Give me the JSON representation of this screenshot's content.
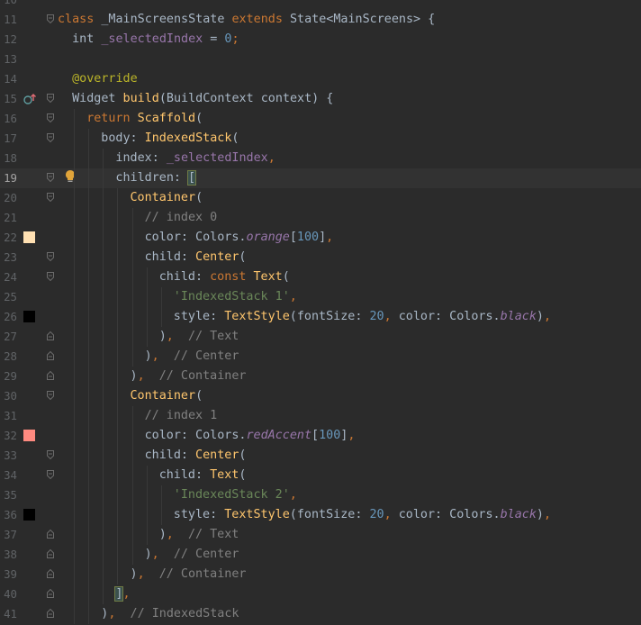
{
  "editor": {
    "colors": {
      "background": "#2b2b2b",
      "caret_line": "#323232",
      "orange_100": "#ffe0b2",
      "red_accent_100": "#ff8a80",
      "black": "#000000",
      "bulb": "#e0a43a"
    },
    "lines": [
      {
        "number": "10",
        "indent": 0,
        "fold": "",
        "gutter": "",
        "tokens": []
      },
      {
        "number": "11",
        "indent": 0,
        "fold": "open",
        "gutter": "",
        "tokens": [
          {
            "t": "class ",
            "c": "keyword"
          },
          {
            "t": "_MainScreensState ",
            "c": "plain"
          },
          {
            "t": "extends ",
            "c": "keyword"
          },
          {
            "t": "State<MainScreens> {",
            "c": "plain"
          }
        ]
      },
      {
        "number": "12",
        "indent": 1,
        "fold": "",
        "gutter": "",
        "tokens": [
          {
            "t": "int ",
            "c": "plain"
          },
          {
            "t": "_selectedIndex",
            "c": "field"
          },
          {
            "t": " = ",
            "c": "plain"
          },
          {
            "t": "0",
            "c": "number"
          },
          {
            "t": ";",
            "c": "keyword"
          }
        ]
      },
      {
        "number": "13",
        "indent": 0,
        "fold": "",
        "gutter": "",
        "tokens": []
      },
      {
        "number": "14",
        "indent": 1,
        "fold": "",
        "gutter": "",
        "tokens": [
          {
            "t": "@override",
            "c": "annotation"
          }
        ]
      },
      {
        "number": "15",
        "indent": 1,
        "fold": "open",
        "gutter": "override-icon",
        "tokens": [
          {
            "t": "Widget ",
            "c": "plain"
          },
          {
            "t": "build",
            "c": "method"
          },
          {
            "t": "(BuildContext context) {",
            "c": "plain"
          }
        ]
      },
      {
        "number": "16",
        "indent": 2,
        "fold": "open",
        "gutter": "",
        "tokens": [
          {
            "t": "return ",
            "c": "keyword"
          },
          {
            "t": "Scaffold",
            "c": "class"
          },
          {
            "t": "(",
            "c": "plain"
          }
        ]
      },
      {
        "number": "17",
        "indent": 3,
        "fold": "open",
        "gutter": "",
        "tokens": [
          {
            "t": "body: ",
            "c": "named"
          },
          {
            "t": "IndexedStack",
            "c": "class"
          },
          {
            "t": "(",
            "c": "plain"
          }
        ]
      },
      {
        "number": "18",
        "indent": 4,
        "fold": "",
        "gutter": "",
        "tokens": [
          {
            "t": "index: ",
            "c": "named"
          },
          {
            "t": "_selectedIndex",
            "c": "field"
          },
          {
            "t": ",",
            "c": "keyword"
          }
        ]
      },
      {
        "number": "19",
        "indent": 4,
        "fold": "open",
        "gutter": "",
        "caret_line": true,
        "bulb": true,
        "tokens": [
          {
            "t": "children: ",
            "c": "named"
          },
          {
            "t": "[",
            "c": "bracket-match"
          },
          {
            "t": "",
            "c": "caret"
          }
        ]
      },
      {
        "number": "20",
        "indent": 5,
        "fold": "open",
        "gutter": "",
        "tokens": [
          {
            "t": "Container",
            "c": "class"
          },
          {
            "t": "(",
            "c": "plain"
          }
        ]
      },
      {
        "number": "21",
        "indent": 6,
        "fold": "",
        "gutter": "",
        "tokens": [
          {
            "t": "// index 0",
            "c": "comment"
          }
        ]
      },
      {
        "number": "22",
        "indent": 6,
        "fold": "",
        "gutter": "swatch-orange",
        "tokens": [
          {
            "t": "color: ",
            "c": "named"
          },
          {
            "t": "Colors.",
            "c": "plain"
          },
          {
            "t": "orange",
            "c": "static"
          },
          {
            "t": "[",
            "c": "plain"
          },
          {
            "t": "100",
            "c": "number"
          },
          {
            "t": "]",
            "c": "plain"
          },
          {
            "t": ",",
            "c": "keyword"
          }
        ]
      },
      {
        "number": "23",
        "indent": 6,
        "fold": "open",
        "gutter": "",
        "tokens": [
          {
            "t": "child: ",
            "c": "named"
          },
          {
            "t": "Center",
            "c": "class"
          },
          {
            "t": "(",
            "c": "plain"
          }
        ]
      },
      {
        "number": "24",
        "indent": 7,
        "fold": "open",
        "gutter": "",
        "tokens": [
          {
            "t": "child: ",
            "c": "named"
          },
          {
            "t": "const ",
            "c": "keyword"
          },
          {
            "t": "Text",
            "c": "class"
          },
          {
            "t": "(",
            "c": "plain"
          }
        ]
      },
      {
        "number": "25",
        "indent": 8,
        "fold": "",
        "gutter": "",
        "tokens": [
          {
            "t": "'IndexedStack 1'",
            "c": "string"
          },
          {
            "t": ",",
            "c": "keyword"
          }
        ]
      },
      {
        "number": "26",
        "indent": 8,
        "fold": "",
        "gutter": "swatch-black",
        "tokens": [
          {
            "t": "style: ",
            "c": "named"
          },
          {
            "t": "TextStyle",
            "c": "class"
          },
          {
            "t": "(fontSize: ",
            "c": "plain"
          },
          {
            "t": "20",
            "c": "number"
          },
          {
            "t": ", ",
            "c": "keyword"
          },
          {
            "t": "color: ",
            "c": "named"
          },
          {
            "t": "Colors.",
            "c": "plain"
          },
          {
            "t": "black",
            "c": "static"
          },
          {
            "t": ")",
            "c": "plain"
          },
          {
            "t": ",",
            "c": "keyword"
          }
        ]
      },
      {
        "number": "27",
        "indent": 7,
        "fold": "close",
        "gutter": "",
        "tokens": [
          {
            "t": ")",
            "c": "plain"
          },
          {
            "t": ",  ",
            "c": "keyword"
          },
          {
            "t": "// Text",
            "c": "comment"
          }
        ]
      },
      {
        "number": "28",
        "indent": 6,
        "fold": "close",
        "gutter": "",
        "tokens": [
          {
            "t": ")",
            "c": "plain"
          },
          {
            "t": ",  ",
            "c": "keyword"
          },
          {
            "t": "// Center",
            "c": "comment"
          }
        ]
      },
      {
        "number": "29",
        "indent": 5,
        "fold": "close",
        "gutter": "",
        "tokens": [
          {
            "t": ")",
            "c": "plain"
          },
          {
            "t": ",  ",
            "c": "keyword"
          },
          {
            "t": "// Container",
            "c": "comment"
          }
        ]
      },
      {
        "number": "30",
        "indent": 5,
        "fold": "open",
        "gutter": "",
        "tokens": [
          {
            "t": "Container",
            "c": "class"
          },
          {
            "t": "(",
            "c": "plain"
          }
        ]
      },
      {
        "number": "31",
        "indent": 6,
        "fold": "",
        "gutter": "",
        "tokens": [
          {
            "t": "// index 1",
            "c": "comment"
          }
        ]
      },
      {
        "number": "32",
        "indent": 6,
        "fold": "",
        "gutter": "swatch-red",
        "tokens": [
          {
            "t": "color: ",
            "c": "named"
          },
          {
            "t": "Colors.",
            "c": "plain"
          },
          {
            "t": "redAccent",
            "c": "static"
          },
          {
            "t": "[",
            "c": "plain"
          },
          {
            "t": "100",
            "c": "number"
          },
          {
            "t": "]",
            "c": "plain"
          },
          {
            "t": ",",
            "c": "keyword"
          }
        ]
      },
      {
        "number": "33",
        "indent": 6,
        "fold": "open",
        "gutter": "",
        "tokens": [
          {
            "t": "child: ",
            "c": "named"
          },
          {
            "t": "Center",
            "c": "class"
          },
          {
            "t": "(",
            "c": "plain"
          }
        ]
      },
      {
        "number": "34",
        "indent": 7,
        "fold": "open",
        "gutter": "",
        "tokens": [
          {
            "t": "child: ",
            "c": "named"
          },
          {
            "t": "Text",
            "c": "class"
          },
          {
            "t": "(",
            "c": "plain"
          }
        ]
      },
      {
        "number": "35",
        "indent": 8,
        "fold": "",
        "gutter": "",
        "tokens": [
          {
            "t": "'IndexedStack 2'",
            "c": "string"
          },
          {
            "t": ",",
            "c": "keyword"
          }
        ]
      },
      {
        "number": "36",
        "indent": 8,
        "fold": "",
        "gutter": "swatch-black",
        "tokens": [
          {
            "t": "style: ",
            "c": "named"
          },
          {
            "t": "TextStyle",
            "c": "class"
          },
          {
            "t": "(fontSize: ",
            "c": "plain"
          },
          {
            "t": "20",
            "c": "number"
          },
          {
            "t": ", ",
            "c": "keyword"
          },
          {
            "t": "color: ",
            "c": "named"
          },
          {
            "t": "Colors.",
            "c": "plain"
          },
          {
            "t": "black",
            "c": "static"
          },
          {
            "t": ")",
            "c": "plain"
          },
          {
            "t": ",",
            "c": "keyword"
          }
        ]
      },
      {
        "number": "37",
        "indent": 7,
        "fold": "close",
        "gutter": "",
        "tokens": [
          {
            "t": ")",
            "c": "plain"
          },
          {
            "t": ",  ",
            "c": "keyword"
          },
          {
            "t": "// Text",
            "c": "comment"
          }
        ]
      },
      {
        "number": "38",
        "indent": 6,
        "fold": "close",
        "gutter": "",
        "tokens": [
          {
            "t": ")",
            "c": "plain"
          },
          {
            "t": ",  ",
            "c": "keyword"
          },
          {
            "t": "// Center",
            "c": "comment"
          }
        ]
      },
      {
        "number": "39",
        "indent": 5,
        "fold": "close",
        "gutter": "",
        "tokens": [
          {
            "t": ")",
            "c": "plain"
          },
          {
            "t": ",  ",
            "c": "keyword"
          },
          {
            "t": "// Container",
            "c": "comment"
          }
        ]
      },
      {
        "number": "40",
        "indent": 4,
        "fold": "close",
        "gutter": "",
        "tokens": [
          {
            "t": "]",
            "c": "bracket-match"
          },
          {
            "t": ",",
            "c": "keyword"
          }
        ]
      },
      {
        "number": "41",
        "indent": 3,
        "fold": "close",
        "gutter": "",
        "tokens": [
          {
            "t": ")",
            "c": "plain"
          },
          {
            "t": ",  ",
            "c": "keyword"
          },
          {
            "t": "// IndexedStack",
            "c": "comment"
          }
        ]
      }
    ]
  }
}
